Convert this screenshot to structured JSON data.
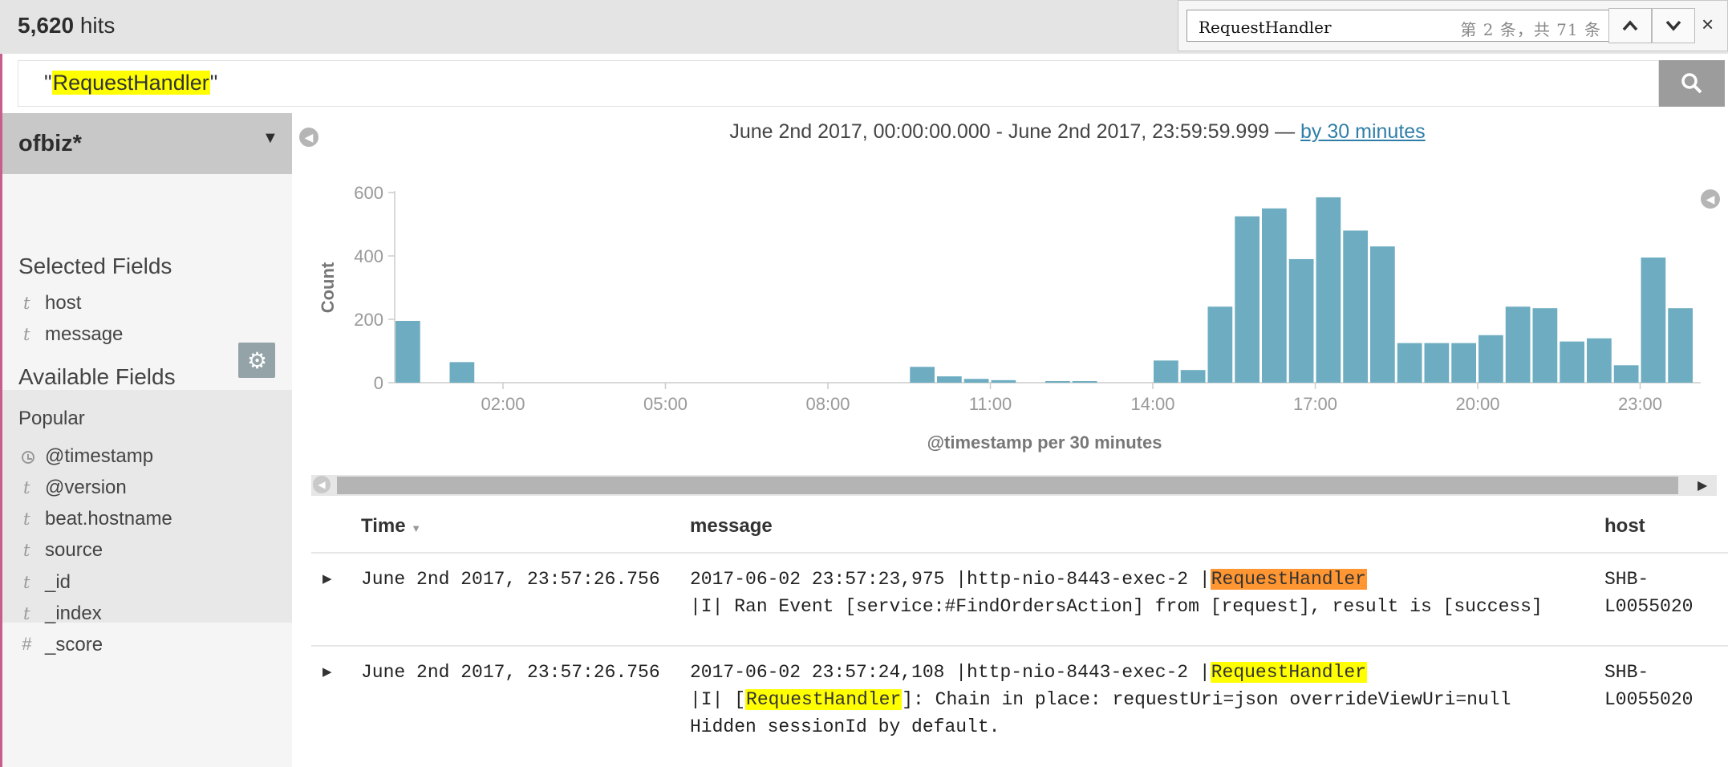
{
  "header": {
    "hits_count": "5,620",
    "hits_label": "hits"
  },
  "find_bar": {
    "query": "RequestHandler",
    "match_status": "第 2 条，共 71 条",
    "prev_icon": "chevron-up-icon",
    "next_icon": "chevron-down-icon",
    "close_label": "×"
  },
  "search": {
    "quote_open": "\"",
    "term": "RequestHandler",
    "quote_close": "\"",
    "button_icon": "search-icon"
  },
  "sidebar": {
    "index_pattern": "ofbiz*",
    "selected_title": "Selected Fields",
    "selected_fields": [
      {
        "type": "t",
        "name": "host"
      },
      {
        "type": "t",
        "name": "message"
      }
    ],
    "available_title": "Available Fields",
    "popular_title": "Popular",
    "popular_fields": [
      {
        "type": "clock",
        "name": "@timestamp"
      },
      {
        "type": "t",
        "name": "@version"
      },
      {
        "type": "t",
        "name": "beat.hostname"
      },
      {
        "type": "t",
        "name": "source"
      }
    ],
    "other_fields": [
      {
        "type": "t",
        "name": "_id"
      },
      {
        "type": "t",
        "name": "_index"
      },
      {
        "type": "#",
        "name": "_score"
      }
    ]
  },
  "time_range": {
    "text": "June 2nd 2017, 00:00:00.000 - June 2nd 2017, 23:59:59.999 — ",
    "interval_link": "by 30 minutes"
  },
  "chart_data": {
    "type": "bar",
    "title": "",
    "ylabel": "Count",
    "xlabel": "@timestamp per 30 minutes",
    "ylim": [
      0,
      600
    ],
    "yticks": [
      0,
      200,
      400,
      600
    ],
    "xticks": [
      "02:00",
      "05:00",
      "08:00",
      "11:00",
      "14:00",
      "17:00",
      "20:00",
      "23:00"
    ],
    "bar_color": "#6eadc1",
    "x": [
      "00:00",
      "00:30",
      "01:00",
      "01:30",
      "02:00",
      "02:30",
      "03:00",
      "03:30",
      "04:00",
      "04:30",
      "05:00",
      "05:30",
      "06:00",
      "06:30",
      "07:00",
      "07:30",
      "08:00",
      "08:30",
      "09:00",
      "09:30",
      "10:00",
      "10:30",
      "11:00",
      "11:30",
      "12:00",
      "12:30",
      "13:00",
      "13:30",
      "14:00",
      "14:30",
      "15:00",
      "15:30",
      "16:00",
      "16:30",
      "17:00",
      "17:30",
      "18:00",
      "18:30",
      "19:00",
      "19:30",
      "20:00",
      "20:30",
      "21:00",
      "21:30",
      "22:00",
      "22:30",
      "23:00",
      "23:30"
    ],
    "values": [
      195,
      0,
      65,
      0,
      0,
      0,
      0,
      0,
      0,
      0,
      0,
      0,
      0,
      0,
      0,
      0,
      0,
      0,
      0,
      50,
      20,
      12,
      8,
      0,
      5,
      5,
      0,
      0,
      70,
      40,
      240,
      525,
      550,
      390,
      585,
      480,
      430,
      125,
      125,
      125,
      150,
      240,
      235,
      130,
      140,
      55,
      395,
      235
    ]
  },
  "table": {
    "columns": [
      "Time",
      "message",
      "host"
    ],
    "rows": [
      {
        "time": "June 2nd 2017, 23:57:26.756",
        "msg_line1_prefix": "2017-06-02 23:57:23,975 |http-nio-8443-exec-2 |",
        "msg_line1_highlight": "RequestHandler",
        "msg_line2": "|I| Ran Event [service:#FindOrdersAction] from [request], result is [success]",
        "host_line1": "SHB-",
        "host_line2": "L0055020"
      },
      {
        "time": "June 2nd 2017, 23:57:26.756",
        "msg_line1_prefix": "2017-06-02 23:57:24,108 |http-nio-8443-exec-2 |",
        "msg_line1_highlight": "RequestHandler",
        "msg_line2_prefix": "|I| [",
        "msg_line2_highlight": "RequestHandler",
        "msg_line2_suffix": "]: Chain in place: requestUri=json overrideViewUri=null",
        "msg_line3": "Hidden sessionId by default.",
        "host_line1": "SHB-",
        "host_line2": "L0055020"
      }
    ]
  }
}
